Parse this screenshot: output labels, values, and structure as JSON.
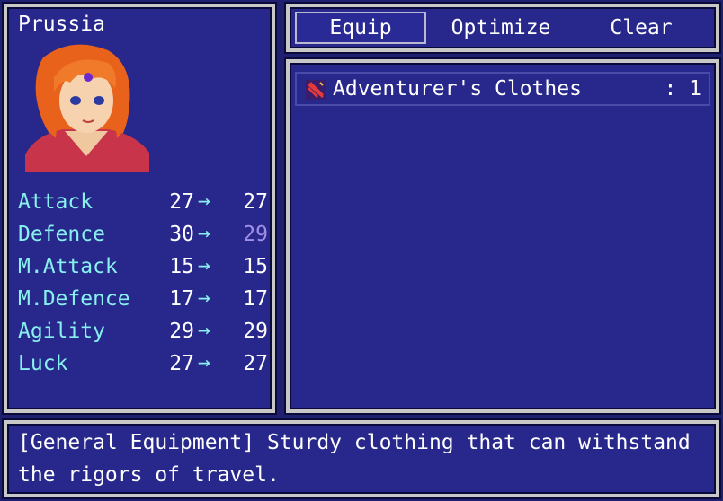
{
  "actor": {
    "name": "Prussia",
    "stats": [
      {
        "label": "Attack",
        "current": "27",
        "new": "27",
        "change": "same"
      },
      {
        "label": "Defence",
        "current": "30",
        "new": "29",
        "change": "down"
      },
      {
        "label": "M.Attack",
        "current": "15",
        "new": "15",
        "change": "same"
      },
      {
        "label": "M.Defence",
        "current": "17",
        "new": "17",
        "change": "same"
      },
      {
        "label": "Agility",
        "current": "29",
        "new": "29",
        "change": "same"
      },
      {
        "label": "Luck",
        "current": "27",
        "new": "27",
        "change": "same"
      }
    ],
    "arrow": "→"
  },
  "commands": [
    {
      "label": "Equip",
      "selected": true
    },
    {
      "label": "Optimize",
      "selected": false
    },
    {
      "label": "Clear",
      "selected": false
    }
  ],
  "items": [
    {
      "name": "Adventurer's Clothes",
      "count": ": 1",
      "icon": "clothes-icon"
    }
  ],
  "help": {
    "line1": "[General Equipment] Sturdy clothing that can withstand",
    "line2": "the rigors of travel."
  },
  "colors": {
    "window_bg": "#27278c",
    "system_text": "#88f0ee",
    "stat_down": "#a090e8"
  }
}
